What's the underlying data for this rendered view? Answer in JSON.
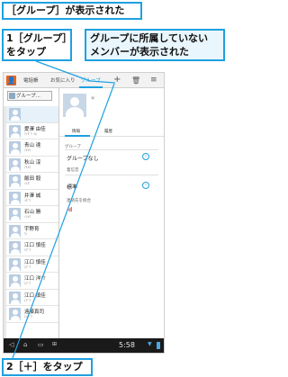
{
  "callouts": {
    "title": "［グループ］が表示された",
    "step1_line1": "1［グループ］",
    "step1_line2": "をタップ",
    "note_line1": "グループに所属していない",
    "note_line2": "メンバーが表示された",
    "step2": "2［＋］をタップ"
  },
  "actionbar": {
    "tabs": [
      "電話帳",
      "お気に入り",
      "グループ"
    ],
    "selected_tab": "グループ",
    "icons": [
      "contacts-app-icon",
      "add-icon",
      "trash-icon",
      "menu-icon"
    ]
  },
  "group_panel": {
    "selector_label": "グループ..."
  },
  "contacts": [
    {
      "name": "",
      "reading": ""
    },
    {
      "name": "愛澤 由佳",
      "reading": "ｱｲｻﾞﾜ ﾕｶ"
    },
    {
      "name": "青山 達",
      "reading": "ｱｵﾔﾏ"
    },
    {
      "name": "秋山 淳",
      "reading": "ｱｷﾔﾏ"
    },
    {
      "name": "飯田 毅",
      "reading": "ｲｲﾀﾞ"
    },
    {
      "name": "井澤 誠",
      "reading": "ｲｻﾞﾜ"
    },
    {
      "name": "石山 勝",
      "reading": "ｲｼﾔﾏ"
    },
    {
      "name": "宇野育",
      "reading": "ｳﾉ"
    },
    {
      "name": "江口 慎佳",
      "reading": "ｴｸﾞﾁ"
    },
    {
      "name": "江口 慎佳",
      "reading": "ｴｸﾞﾁ"
    },
    {
      "name": "江口 洋介",
      "reading": "ｴｸﾞﾁ"
    },
    {
      "name": "江口 慎佳",
      "reading": "ｴｸﾞﾁ"
    },
    {
      "name": "遠藤真司",
      "reading": "ｴﾝﾄﾞｳ"
    }
  ],
  "detail": {
    "tabs": [
      "情報",
      "履歴"
    ],
    "group_section_label": "グループ",
    "group_value": "グループなし",
    "ringtone_label": "着信音",
    "ringtone_value": "標準",
    "add_account_label": "連絡先を統合"
  },
  "status_bar": {
    "time": "5:58"
  },
  "colors": {
    "accent": "#1ea0e0",
    "app_icon": "#e8641c",
    "note_bg": "#e9f6fd"
  }
}
